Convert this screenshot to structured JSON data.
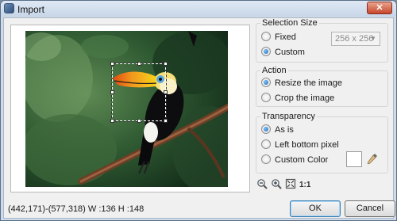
{
  "window": {
    "title": "Import",
    "close_label": "✕"
  },
  "selection_size": {
    "title": "Selection Size",
    "options": [
      {
        "label": "Fixed",
        "selected": false
      },
      {
        "label": "Custom",
        "selected": true
      }
    ],
    "fixed_size_value": "256 x 256"
  },
  "action": {
    "title": "Action",
    "options": [
      {
        "label": "Resize the image",
        "selected": true
      },
      {
        "label": "Crop the image",
        "selected": false
      }
    ]
  },
  "transparency": {
    "title": "Transparency",
    "options": [
      {
        "label": "As is",
        "selected": true
      },
      {
        "label": "Left bottom pixel",
        "selected": false
      },
      {
        "label": "Custom Color",
        "selected": false
      }
    ],
    "custom_color": "#ffffff"
  },
  "toolbar": {
    "icons": [
      "zoom-out-icon",
      "zoom-in-icon",
      "fit-to-window-icon",
      "actual-size-icon"
    ]
  },
  "status": {
    "text": "(442,171)-(577,318) W :136 H :148"
  },
  "buttons": {
    "ok": "OK",
    "cancel": "Cancel"
  },
  "colors": {
    "window_frame": "#cfdbe8",
    "accent": "#1c6bb8",
    "close": "#c7462b"
  }
}
